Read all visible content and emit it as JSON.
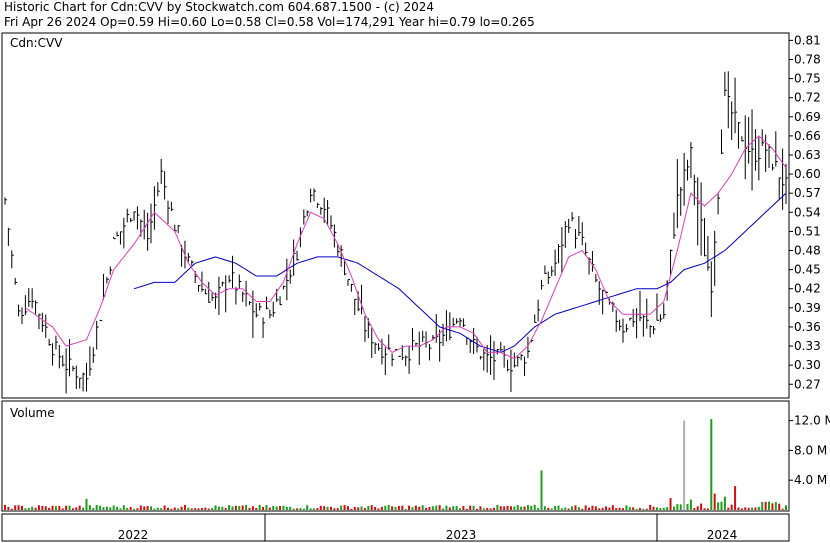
{
  "header": {
    "line1": "Historic Chart for Cdn:CVV by Stockwatch.com 604.687.1500 - (c) 2024",
    "line2": "Fri Apr 26 2024   Op=0.59  Hi=0.60  Lo=0.58  Cl=0.58  Vol=174,291  Year hi=0.79  lo=0.265"
  },
  "chart_data": [
    {
      "type": "line",
      "title": "Cdn:CVV",
      "ylim": [
        0.25,
        0.82
      ],
      "yticks": [
        0.27,
        0.3,
        0.33,
        0.36,
        0.39,
        0.42,
        0.45,
        0.48,
        0.51,
        0.54,
        0.57,
        0.6,
        0.63,
        0.66,
        0.69,
        0.72,
        0.75,
        0.78,
        0.81
      ],
      "ytick_labels": [
        "0.27",
        "0.30",
        "0.33",
        "0.36",
        "0.39",
        "0.42",
        "0.45",
        "0.48",
        "0.51",
        "0.54",
        "0.57",
        "0.60",
        "0.63",
        "0.66",
        "0.69",
        "0.72",
        "0.75",
        "0.78",
        "0.81"
      ],
      "x_labels": [
        "2022",
        "2023",
        "2024"
      ],
      "colors": {
        "price": "#000000",
        "ma_short": "#e040c0",
        "ma_long": "#0000c0"
      },
      "price_anchors": [
        [
          0,
          0.56
        ],
        [
          4,
          0.38
        ],
        [
          8,
          0.41
        ],
        [
          14,
          0.33
        ],
        [
          18,
          0.3
        ],
        [
          24,
          0.28
        ],
        [
          28,
          0.38
        ],
        [
          32,
          0.49
        ],
        [
          38,
          0.55
        ],
        [
          42,
          0.5
        ],
        [
          46,
          0.6
        ],
        [
          50,
          0.52
        ],
        [
          54,
          0.46
        ],
        [
          58,
          0.42
        ],
        [
          62,
          0.4
        ],
        [
          66,
          0.44
        ],
        [
          70,
          0.41
        ],
        [
          74,
          0.38
        ],
        [
          78,
          0.38
        ],
        [
          82,
          0.42
        ],
        [
          86,
          0.48
        ],
        [
          90,
          0.58
        ],
        [
          94,
          0.55
        ],
        [
          98,
          0.49
        ],
        [
          102,
          0.42
        ],
        [
          106,
          0.36
        ],
        [
          110,
          0.33
        ],
        [
          114,
          0.32
        ],
        [
          118,
          0.32
        ],
        [
          122,
          0.33
        ],
        [
          126,
          0.33
        ],
        [
          130,
          0.35
        ],
        [
          134,
          0.38
        ],
        [
          138,
          0.33
        ],
        [
          142,
          0.31
        ],
        [
          146,
          0.31
        ],
        [
          150,
          0.3
        ],
        [
          154,
          0.32
        ],
        [
          158,
          0.42
        ],
        [
          162,
          0.46
        ],
        [
          166,
          0.53
        ],
        [
          170,
          0.49
        ],
        [
          174,
          0.43
        ],
        [
          178,
          0.39
        ],
        [
          182,
          0.36
        ],
        [
          186,
          0.38
        ],
        [
          190,
          0.36
        ],
        [
          194,
          0.38
        ],
        [
          198,
          0.56
        ],
        [
          202,
          0.63
        ],
        [
          206,
          0.48
        ],
        [
          208,
          0.43
        ],
        [
          212,
          0.72
        ],
        [
          216,
          0.67
        ],
        [
          220,
          0.63
        ],
        [
          224,
          0.64
        ],
        [
          228,
          0.6
        ],
        [
          230,
          0.58
        ]
      ],
      "ma_short_anchors": [
        [
          6,
          0.39
        ],
        [
          14,
          0.36
        ],
        [
          18,
          0.33
        ],
        [
          24,
          0.34
        ],
        [
          28,
          0.39
        ],
        [
          32,
          0.45
        ],
        [
          38,
          0.49
        ],
        [
          44,
          0.54
        ],
        [
          50,
          0.51
        ],
        [
          54,
          0.46
        ],
        [
          58,
          0.43
        ],
        [
          62,
          0.41
        ],
        [
          66,
          0.42
        ],
        [
          70,
          0.42
        ],
        [
          74,
          0.4
        ],
        [
          78,
          0.4
        ],
        [
          82,
          0.43
        ],
        [
          86,
          0.49
        ],
        [
          90,
          0.54
        ],
        [
          94,
          0.53
        ],
        [
          98,
          0.49
        ],
        [
          102,
          0.44
        ],
        [
          106,
          0.38
        ],
        [
          110,
          0.34
        ],
        [
          114,
          0.32
        ],
        [
          118,
          0.33
        ],
        [
          122,
          0.33
        ],
        [
          126,
          0.34
        ],
        [
          130,
          0.36
        ],
        [
          134,
          0.36
        ],
        [
          138,
          0.35
        ],
        [
          142,
          0.32
        ],
        [
          146,
          0.32
        ],
        [
          150,
          0.31
        ],
        [
          154,
          0.33
        ],
        [
          158,
          0.37
        ],
        [
          162,
          0.42
        ],
        [
          166,
          0.47
        ],
        [
          170,
          0.48
        ],
        [
          174,
          0.45
        ],
        [
          178,
          0.4
        ],
        [
          182,
          0.38
        ],
        [
          186,
          0.38
        ],
        [
          190,
          0.38
        ],
        [
          194,
          0.4
        ],
        [
          198,
          0.48
        ],
        [
          202,
          0.57
        ],
        [
          206,
          0.55
        ],
        [
          210,
          0.57
        ],
        [
          214,
          0.6
        ],
        [
          218,
          0.64
        ],
        [
          222,
          0.66
        ],
        [
          226,
          0.64
        ],
        [
          230,
          0.61
        ]
      ],
      "ma_long_anchors": [
        [
          38,
          0.42
        ],
        [
          44,
          0.43
        ],
        [
          50,
          0.43
        ],
        [
          56,
          0.46
        ],
        [
          62,
          0.47
        ],
        [
          68,
          0.46
        ],
        [
          74,
          0.44
        ],
        [
          80,
          0.44
        ],
        [
          86,
          0.46
        ],
        [
          92,
          0.47
        ],
        [
          98,
          0.47
        ],
        [
          104,
          0.46
        ],
        [
          110,
          0.44
        ],
        [
          116,
          0.42
        ],
        [
          122,
          0.39
        ],
        [
          128,
          0.36
        ],
        [
          134,
          0.35
        ],
        [
          140,
          0.33
        ],
        [
          146,
          0.32
        ],
        [
          150,
          0.33
        ],
        [
          156,
          0.36
        ],
        [
          162,
          0.38
        ],
        [
          168,
          0.39
        ],
        [
          174,
          0.4
        ],
        [
          180,
          0.41
        ],
        [
          186,
          0.42
        ],
        [
          192,
          0.42
        ],
        [
          196,
          0.43
        ],
        [
          200,
          0.45
        ],
        [
          206,
          0.46
        ],
        [
          212,
          0.48
        ],
        [
          218,
          0.51
        ],
        [
          224,
          0.54
        ],
        [
          230,
          0.57
        ]
      ]
    },
    {
      "type": "bar",
      "title": "Volume",
      "ylim": [
        0,
        14.5
      ],
      "yticks": [
        4,
        8,
        12
      ],
      "ytick_labels": [
        "4.0 M",
        "8.0 M",
        "12.0 M"
      ],
      "spikes": [
        {
          "i": 24,
          "v": 1.5,
          "color": "#1aa01a"
        },
        {
          "i": 158,
          "v": 5.3,
          "color": "#1aa01a"
        },
        {
          "i": 200,
          "v": 12.0,
          "color": "#b0b0b0"
        },
        {
          "i": 208,
          "v": 12.2,
          "color": "#1aa01a"
        },
        {
          "i": 209,
          "v": 2.2,
          "color": "#d01010"
        },
        {
          "i": 215,
          "v": 3.2,
          "color": "#d01010"
        },
        {
          "i": 212,
          "v": 1.8,
          "color": "#1aa01a"
        },
        {
          "i": 196,
          "v": 1.6,
          "color": "#d01010"
        },
        {
          "i": 202,
          "v": 1.4,
          "color": "#1aa01a"
        }
      ]
    }
  ]
}
